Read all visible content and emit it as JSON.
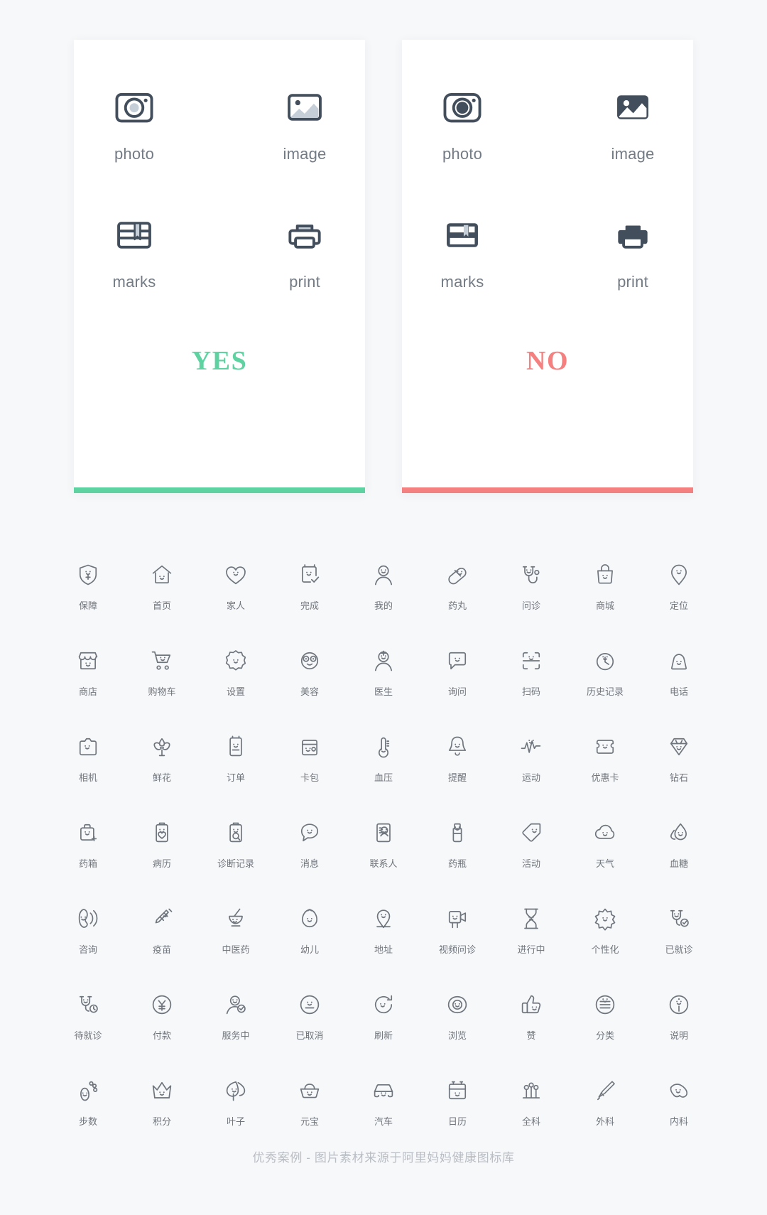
{
  "comparison": {
    "cards": [
      {
        "verdict": "YES",
        "verdict_color": "#5ed2a0",
        "bar_color": "#5ed2a0",
        "style": "outline",
        "items": [
          {
            "label": "photo",
            "icon": "camera-icon"
          },
          {
            "label": "image",
            "icon": "picture-icon"
          },
          {
            "label": "marks",
            "icon": "bookmark-icon"
          },
          {
            "label": "print",
            "icon": "printer-icon"
          }
        ]
      },
      {
        "verdict": "NO",
        "verdict_color": "#f4807f",
        "bar_color": "#f4807f",
        "style": "filled",
        "items": [
          {
            "label": "photo",
            "icon": "camera-icon"
          },
          {
            "label": "image",
            "icon": "picture-icon"
          },
          {
            "label": "marks",
            "icon": "bookmark-icon"
          },
          {
            "label": "print",
            "icon": "printer-icon"
          }
        ]
      }
    ]
  },
  "icon_grid": {
    "columns": 9,
    "items": [
      {
        "label": "保障",
        "icon": "shield-plus-icon"
      },
      {
        "label": "首页",
        "icon": "home-icon"
      },
      {
        "label": "家人",
        "icon": "heart-icon"
      },
      {
        "label": "完成",
        "icon": "check-note-icon"
      },
      {
        "label": "我的",
        "icon": "person-icon"
      },
      {
        "label": "药丸",
        "icon": "pill-icon"
      },
      {
        "label": "问诊",
        "icon": "stethoscope-icon"
      },
      {
        "label": "商城",
        "icon": "shopping-bag-icon"
      },
      {
        "label": "定位",
        "icon": "location-pin-icon"
      },
      {
        "label": "商店",
        "icon": "store-icon"
      },
      {
        "label": "购物车",
        "icon": "shopping-cart-icon"
      },
      {
        "label": "设置",
        "icon": "gear-icon"
      },
      {
        "label": "美容",
        "icon": "beauty-face-icon"
      },
      {
        "label": "医生",
        "icon": "doctor-icon"
      },
      {
        "label": "询问",
        "icon": "chat-bubble-icon"
      },
      {
        "label": "扫码",
        "icon": "scan-code-icon"
      },
      {
        "label": "历史记录",
        "icon": "clock-icon"
      },
      {
        "label": "电话",
        "icon": "telephone-icon"
      },
      {
        "label": "相机",
        "icon": "camera-icon"
      },
      {
        "label": "鲜花",
        "icon": "flower-icon"
      },
      {
        "label": "订单",
        "icon": "order-icon"
      },
      {
        "label": "卡包",
        "icon": "card-holder-icon"
      },
      {
        "label": "血压",
        "icon": "thermometer-icon"
      },
      {
        "label": "提醒",
        "icon": "bell-icon"
      },
      {
        "label": "运动",
        "icon": "heartbeat-icon"
      },
      {
        "label": "优惠卡",
        "icon": "coupon-card-icon"
      },
      {
        "label": "钻石",
        "icon": "diamond-icon"
      },
      {
        "label": "药箱",
        "icon": "medicine-box-icon"
      },
      {
        "label": "病历",
        "icon": "medical-record-icon"
      },
      {
        "label": "诊断记录",
        "icon": "diagnosis-record-icon"
      },
      {
        "label": "消息",
        "icon": "message-icon"
      },
      {
        "label": "联系人",
        "icon": "contact-icon"
      },
      {
        "label": "药瓶",
        "icon": "medicine-bottle-icon"
      },
      {
        "label": "活动",
        "icon": "tag-icon"
      },
      {
        "label": "天气",
        "icon": "cloud-icon"
      },
      {
        "label": "血糖",
        "icon": "blood-drop-icon"
      },
      {
        "label": "咨询",
        "icon": "phone-consult-icon"
      },
      {
        "label": "疫苗",
        "icon": "vaccine-icon"
      },
      {
        "label": "中医药",
        "icon": "mortar-pestle-icon"
      },
      {
        "label": "幼儿",
        "icon": "baby-icon"
      },
      {
        "label": "地址",
        "icon": "address-pin-icon"
      },
      {
        "label": "视频问诊",
        "icon": "video-consult-icon"
      },
      {
        "label": "进行中",
        "icon": "hourglass-icon"
      },
      {
        "label": "个性化",
        "icon": "star-burst-icon"
      },
      {
        "label": "已就诊",
        "icon": "visited-check-icon"
      },
      {
        "label": "待就诊",
        "icon": "pending-visit-icon"
      },
      {
        "label": "付款",
        "icon": "yuan-payment-icon"
      },
      {
        "label": "服务中",
        "icon": "service-icon"
      },
      {
        "label": "已取消",
        "icon": "cancelled-icon"
      },
      {
        "label": "刷新",
        "icon": "refresh-icon"
      },
      {
        "label": "浏览",
        "icon": "eye-icon"
      },
      {
        "label": "赞",
        "icon": "thumbs-up-icon"
      },
      {
        "label": "分类",
        "icon": "category-icon"
      },
      {
        "label": "说明",
        "icon": "info-icon"
      },
      {
        "label": "步数",
        "icon": "footprint-icon"
      },
      {
        "label": "积分",
        "icon": "crown-icon"
      },
      {
        "label": "叶子",
        "icon": "leaf-icon"
      },
      {
        "label": "元宝",
        "icon": "gold-ingot-icon"
      },
      {
        "label": "汽车",
        "icon": "car-icon"
      },
      {
        "label": "日历",
        "icon": "calendar-icon"
      },
      {
        "label": "全科",
        "icon": "general-medicine-icon"
      },
      {
        "label": "外科",
        "icon": "surgery-icon"
      },
      {
        "label": "内科",
        "icon": "internal-medicine-icon"
      }
    ]
  },
  "footer": {
    "text": "优秀案例 - 图片素材来源于阿里妈妈健康图标库"
  },
  "colors": {
    "icon_dark": "#434e5c",
    "icon_fill_light": "#c6ced8",
    "grid_icon": "#6f757d",
    "background": "#f7f8fa",
    "card": "#ffffff"
  }
}
